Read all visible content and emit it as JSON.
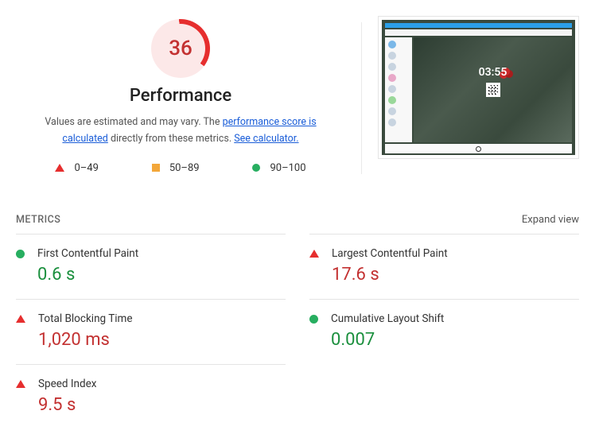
{
  "performance": {
    "score": "36",
    "title": "Performance",
    "desc_part1": "Values are estimated and may vary. The ",
    "link1": "performance score is calculated",
    "desc_part2": " directly from these metrics. ",
    "link2": "See calculator."
  },
  "legend": {
    "poor": "0–49",
    "avg": "50–89",
    "good": "90–100"
  },
  "screenshot": {
    "time": "03:55"
  },
  "metrics_header": {
    "label": "METRICS",
    "expand": "Expand view"
  },
  "metrics": [
    {
      "name": "First Contentful Paint",
      "value": "0.6 s",
      "status": "good"
    },
    {
      "name": "Largest Contentful Paint",
      "value": "17.6 s",
      "status": "poor"
    },
    {
      "name": "Total Blocking Time",
      "value": "1,020 ms",
      "status": "poor"
    },
    {
      "name": "Cumulative Layout Shift",
      "value": "0.007",
      "status": "good"
    },
    {
      "name": "Speed Index",
      "value": "9.5 s",
      "status": "poor"
    }
  ]
}
